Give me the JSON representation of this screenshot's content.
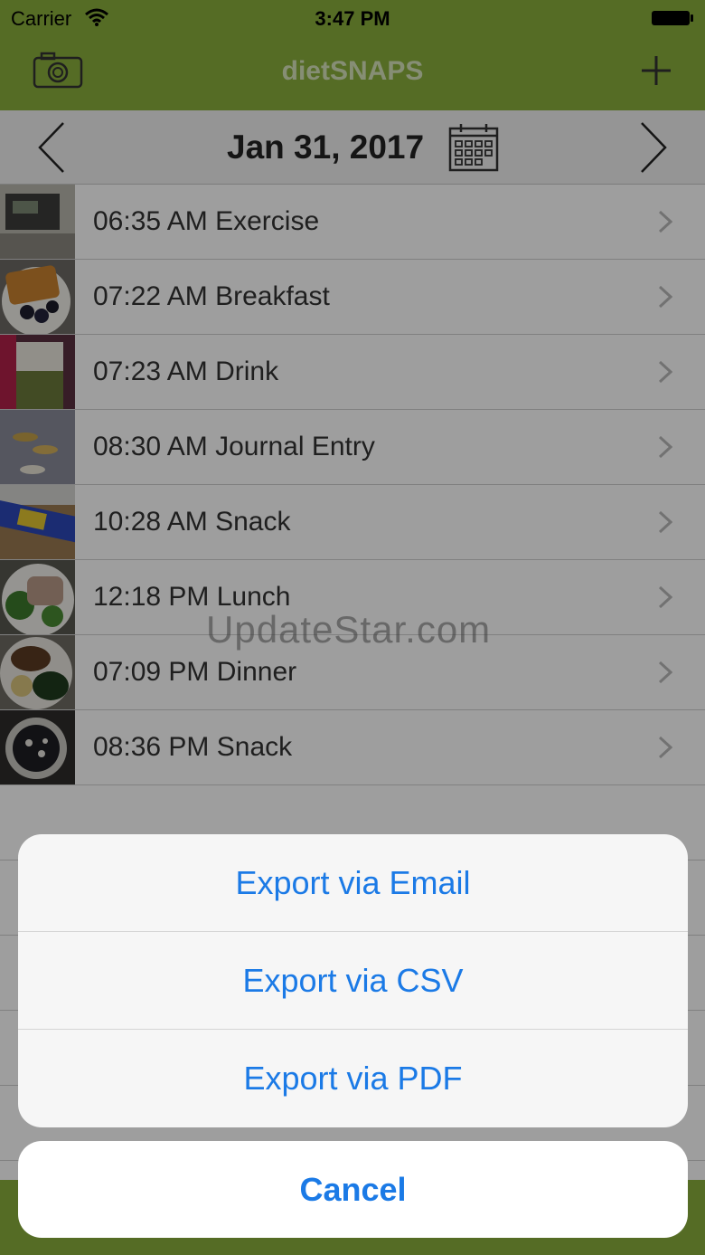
{
  "status_bar": {
    "carrier": "Carrier",
    "time": "3:47 PM"
  },
  "header": {
    "title": "dietSNAPS",
    "left_icon": "camera-icon",
    "right_icon": "add-icon"
  },
  "date_nav": {
    "date": "Jan 31, 2017",
    "prev_icon": "chevron-left-icon",
    "next_icon": "chevron-right-icon",
    "calendar_icon": "calendar-icon"
  },
  "entries": [
    {
      "label": "06:35 AM Exercise"
    },
    {
      "label": "07:22 AM Breakfast"
    },
    {
      "label": "07:23 AM Drink"
    },
    {
      "label": "08:30 AM Journal Entry"
    },
    {
      "label": "10:28 AM Snack"
    },
    {
      "label": "12:18 PM Lunch"
    },
    {
      "label": "07:09 PM Dinner"
    },
    {
      "label": "08:36 PM Snack"
    }
  ],
  "watermark": "UpdateStar.com",
  "action_sheet": {
    "options": [
      "Export via Email",
      "Export via CSV",
      "Export via PDF"
    ],
    "cancel": "Cancel"
  },
  "colors": {
    "brand_green": "#8aae3c",
    "ios_blue": "#1b7ae6"
  }
}
